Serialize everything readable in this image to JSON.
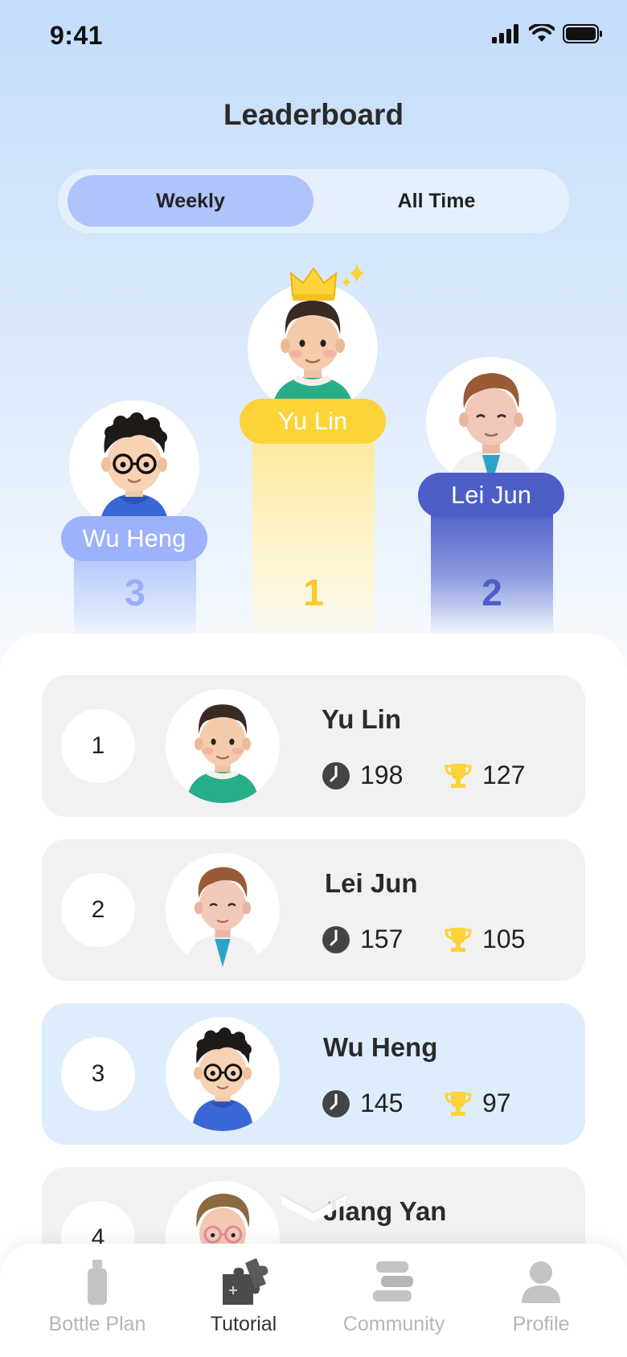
{
  "status_bar": {
    "time": "9:41"
  },
  "page_title": "Leaderboard",
  "segmented": {
    "options": [
      "Weekly",
      "All Time"
    ],
    "selected": "Weekly"
  },
  "podium": {
    "first": {
      "name": "Yu Lin",
      "rank": "1"
    },
    "second": {
      "name": "Lei Jun",
      "rank": "2"
    },
    "third": {
      "name": "Wu Heng",
      "rank": "3"
    }
  },
  "leaderboard": [
    {
      "rank": "1",
      "name": "Yu Lin",
      "time": "198",
      "trophies": "127",
      "highlighted": false
    },
    {
      "rank": "2",
      "name": "Lei Jun",
      "time": "157",
      "trophies": "105",
      "highlighted": false
    },
    {
      "rank": "3",
      "name": "Wu Heng",
      "time": "145",
      "trophies": "97",
      "highlighted": true
    },
    {
      "rank": "4",
      "name": "Jiang Yan"
    }
  ],
  "tabbar": {
    "items": [
      {
        "label": "Bottle Plan",
        "icon": "bottle-icon"
      },
      {
        "label": "Tutorial",
        "icon": "puzzle-icon"
      },
      {
        "label": "Community",
        "icon": "community-icon"
      },
      {
        "label": "Profile",
        "icon": "profile-icon"
      }
    ],
    "active": "Tutorial"
  },
  "colors": {
    "gold": "#fdd33a",
    "silver_blue": "#4d5ec6",
    "bronze_blue": "#8fa7f7",
    "highlight_row": "#deedfc",
    "tab_active_bg": "#aec4fb"
  }
}
